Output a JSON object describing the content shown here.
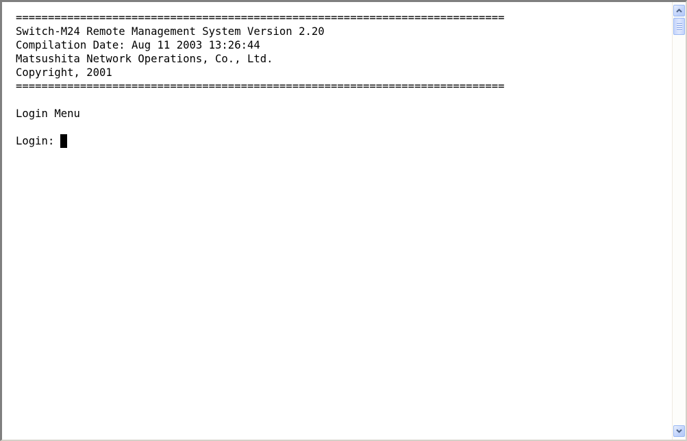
{
  "terminal": {
    "lines": [
      "============================================================================",
      "Switch-M24 Remote Management System Version 2.20",
      "Compilation Date: Aug 11 2003 13:26:44",
      "Matsushita Network Operations, Co., Ltd.",
      "Copyright, 2001",
      "============================================================================"
    ],
    "menu_title": "Login Menu",
    "login_prompt": "Login:"
  },
  "scrollbar": {
    "up_icon": "triangle-up",
    "down_icon": "triangle-down",
    "position": 0
  },
  "colors": {
    "background": "#ffffff",
    "text": "#000000",
    "scroll_accent": "#4d6185"
  }
}
